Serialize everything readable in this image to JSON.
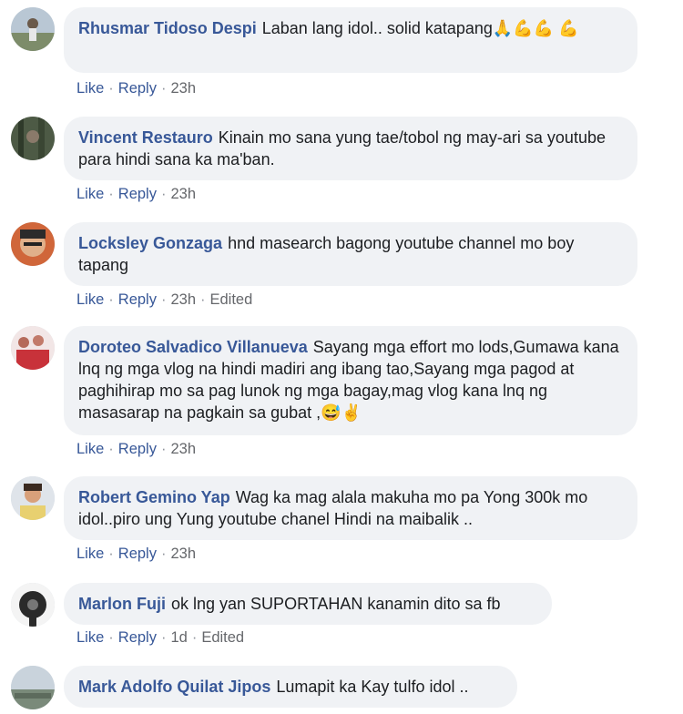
{
  "comments": [
    {
      "author": "Rhusmar Tidoso Despi",
      "text": "Laban lang idol.. solid katapang",
      "emoji": "🙏💪💪 💪",
      "like": "Like",
      "reply": "Reply",
      "time": "23h",
      "edited": ""
    },
    {
      "author": "Vincent Restauro",
      "text": "Kinain mo sana yung tae/tobol ng may-ari sa youtube para hindi sana ka ma'ban.",
      "emoji": "",
      "like": "Like",
      "reply": "Reply",
      "time": "23h",
      "edited": ""
    },
    {
      "author": "Locksley Gonzaga",
      "text": "hnd masearch bagong youtube channel mo boy tapang",
      "emoji": "",
      "like": "Like",
      "reply": "Reply",
      "time": "23h",
      "edited": "Edited"
    },
    {
      "author": "Doroteo Salvadico Villanueva",
      "text": "Sayang mga effort mo lods,Gumawa kana lnq ng mga vlog na hindi madiri ang ibang tao,Sayang mga pagod at paghihirap mo sa pag lunok ng mga bagay,mag vlog kana lnq ng masasarap na pagkain sa gubat ,",
      "emoji": "😅✌",
      "like": "Like",
      "reply": "Reply",
      "time": "23h",
      "edited": ""
    },
    {
      "author": "Robert Gemino Yap",
      "text": "Wag ka mag alala makuha mo pa Yong 300k mo idol..piro ung Yung youtube chanel Hindi na maibalik ..",
      "emoji": "",
      "like": "Like",
      "reply": "Reply",
      "time": "23h",
      "edited": ""
    },
    {
      "author": "Marlon Fuji",
      "text": "ok lng yan SUPORTAHAN kanamin dito sa fb",
      "emoji": "",
      "like": "Like",
      "reply": "Reply",
      "time": "1d",
      "edited": "Edited"
    },
    {
      "author": "Mark Adolfo Quilat Jipos",
      "text": "Lumapit ka Kay tulfo idol ..",
      "emoji": "",
      "like": "",
      "reply": "",
      "time": "",
      "edited": ""
    }
  ],
  "separator": "·"
}
